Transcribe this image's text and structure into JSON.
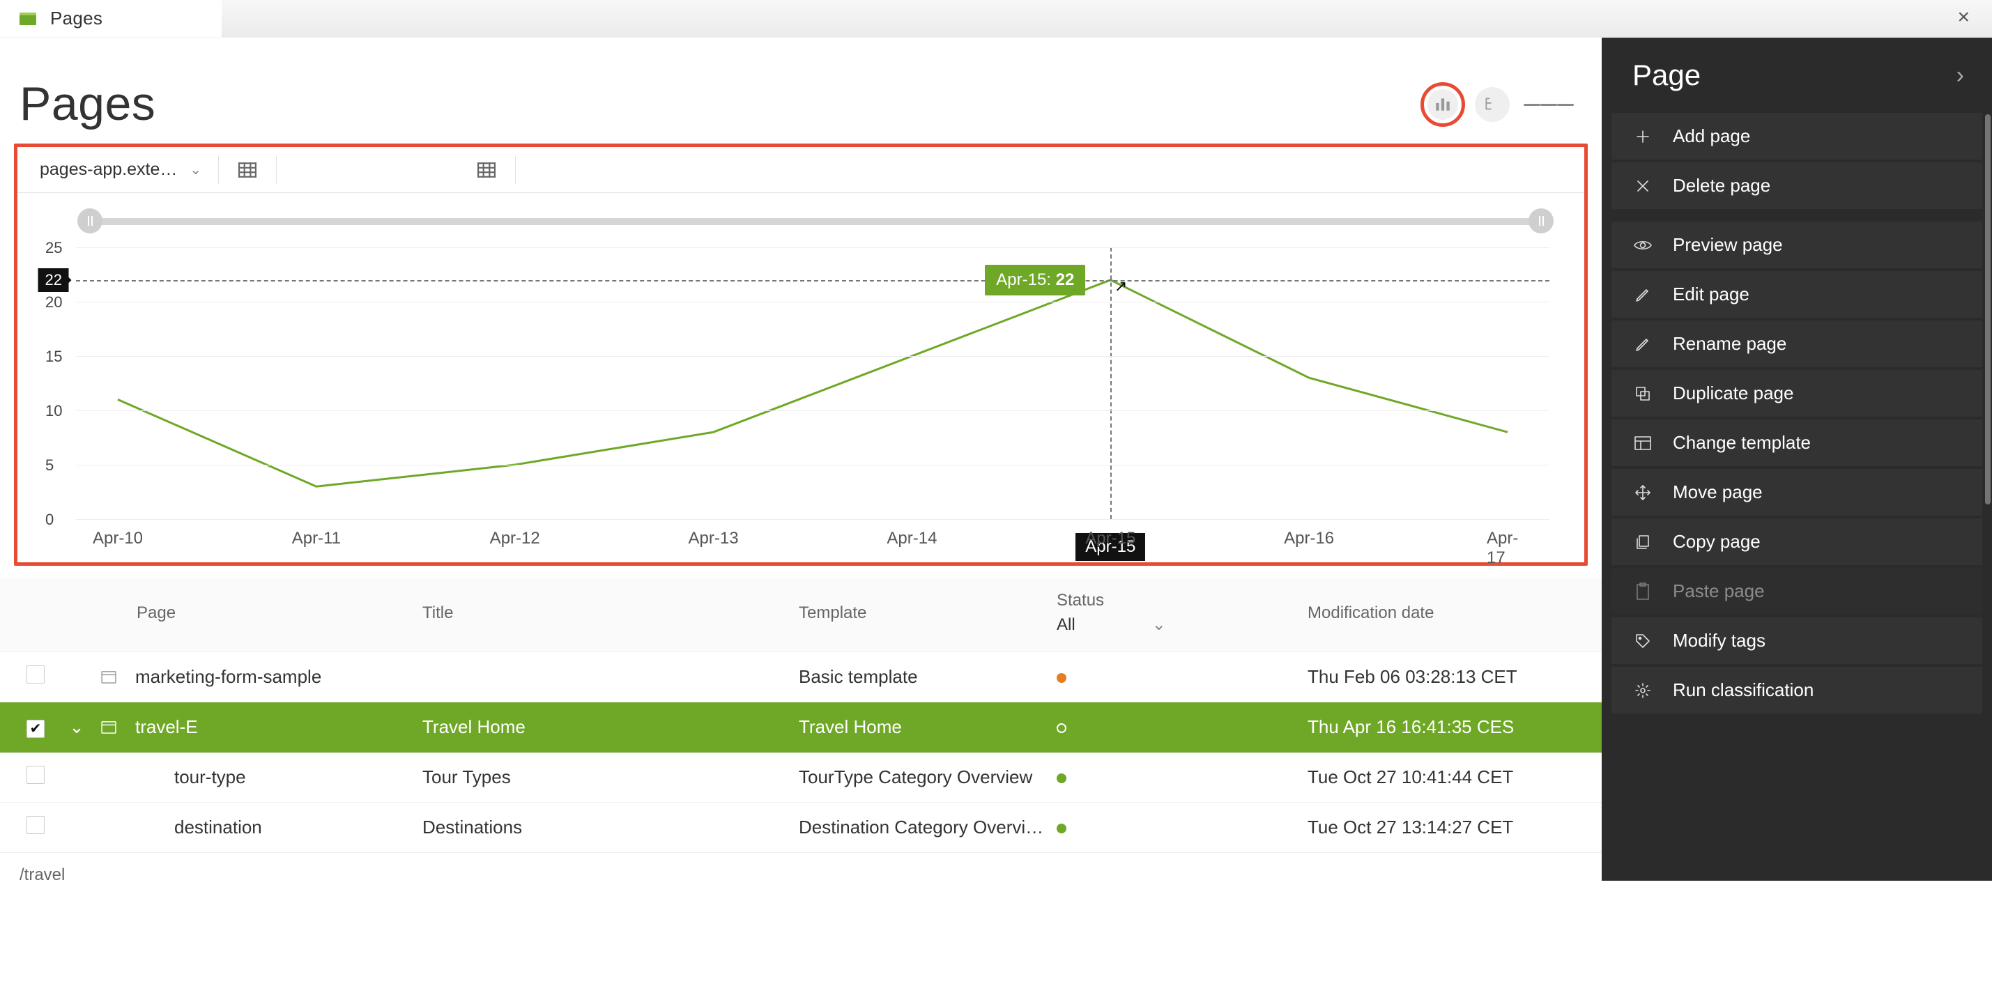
{
  "topbar": {
    "app_label": "Pages"
  },
  "heading": "Pages",
  "toolbar": {
    "selector_label": "pages-app.exte…"
  },
  "chart_data": {
    "type": "line",
    "categories": [
      "Apr-10",
      "Apr-11",
      "Apr-12",
      "Apr-13",
      "Apr-14",
      "Apr-15",
      "Apr-16",
      "Apr-17"
    ],
    "values": [
      11,
      3,
      5,
      8,
      15,
      22,
      13,
      8
    ],
    "xlabel": "",
    "ylabel": "",
    "ylim": [
      0,
      25
    ],
    "yticks": [
      0,
      5,
      10,
      15,
      20,
      25
    ],
    "hover": {
      "index": 5,
      "value": 22,
      "label_x": "Apr-15",
      "tooltip_prefix": "Apr-15: ",
      "tooltip_value": "22",
      "y_badge": "22"
    }
  },
  "table": {
    "columns": {
      "page": "Page",
      "title": "Title",
      "template": "Template",
      "status": "Status",
      "status_filter": "All",
      "moddate": "Modification date"
    },
    "rows": [
      {
        "indent": 1,
        "checked": false,
        "expand": "",
        "page": "marketing-form-sample",
        "title": "",
        "template": "Basic template",
        "status": "orange",
        "moddate": "Thu Feb 06 03:28:13 CET",
        "active": false
      },
      {
        "indent": 1,
        "checked": true,
        "expand": "down",
        "page": "travel-E",
        "title": "Travel Home",
        "template": "Travel Home",
        "status": "ring",
        "moddate": "Thu Apr 16 16:41:35 CES",
        "active": true
      },
      {
        "indent": 2,
        "checked": false,
        "expand": "",
        "page": "tour-type",
        "title": "Tour Types",
        "template": "TourType Category Overview",
        "status": "green",
        "moddate": "Tue Oct 27 10:41:44 CET",
        "active": false
      },
      {
        "indent": 2,
        "checked": false,
        "expand": "",
        "page": "destination",
        "title": "Destinations",
        "template": "Destination Category Overview",
        "status": "green",
        "moddate": "Tue Oct 27 13:14:27 CET",
        "active": false
      }
    ]
  },
  "pathbar": "/travel",
  "panel": {
    "title": "Page",
    "groups": [
      [
        {
          "icon": "plus",
          "label": "Add page",
          "enabled": true
        },
        {
          "icon": "x",
          "label": "Delete page",
          "enabled": true
        }
      ],
      [
        {
          "icon": "eye",
          "label": "Preview page",
          "enabled": true
        },
        {
          "icon": "pencil",
          "label": "Edit page",
          "enabled": true
        },
        {
          "icon": "pencil",
          "label": "Rename page",
          "enabled": true
        },
        {
          "icon": "dup",
          "label": "Duplicate page",
          "enabled": true
        },
        {
          "icon": "tmpl",
          "label": "Change template",
          "enabled": true
        },
        {
          "icon": "move",
          "label": "Move page",
          "enabled": true
        },
        {
          "icon": "copy",
          "label": "Copy page",
          "enabled": true
        },
        {
          "icon": "paste",
          "label": "Paste page",
          "enabled": false
        },
        {
          "icon": "tag",
          "label": "Modify tags",
          "enabled": true
        },
        {
          "icon": "gear",
          "label": "Run classification",
          "enabled": true
        }
      ]
    ]
  }
}
